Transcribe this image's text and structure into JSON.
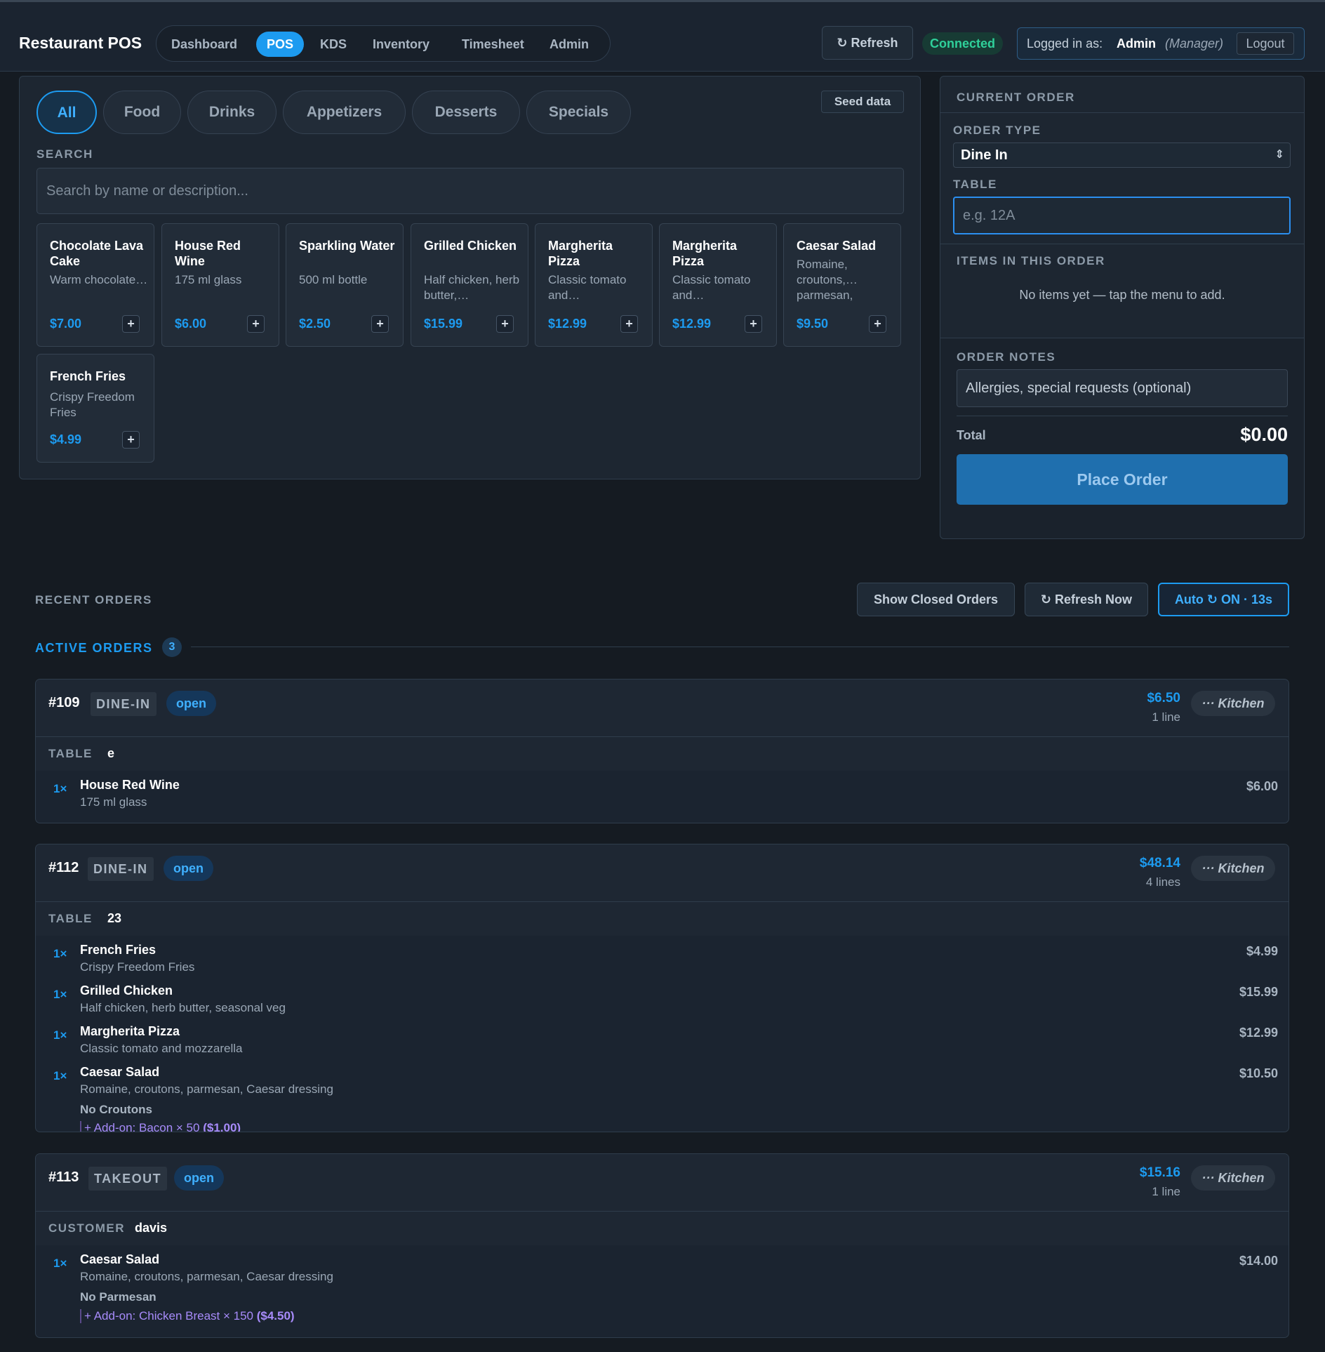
{
  "app": {
    "title": "Restaurant POS"
  },
  "nav": {
    "items": [
      "Dashboard",
      "POS",
      "KDS",
      "Inventory",
      "Timesheet",
      "Admin"
    ],
    "active": "POS"
  },
  "header": {
    "refresh_label": "Refresh",
    "status": "Connected",
    "logged_in_prefix": "Logged in as:",
    "user": "Admin",
    "role": "(Manager)",
    "logout_label": "Logout"
  },
  "menu": {
    "categories": [
      "All",
      "Food",
      "Drinks",
      "Appetizers",
      "Desserts",
      "Specials"
    ],
    "active_category": "All",
    "seed_label": "Seed data",
    "search_label": "SEARCH",
    "search_placeholder": "Search by name or description...",
    "items": [
      {
        "name": "Chocolate Lava Cake",
        "desc": "Warm chocolate…",
        "price": "$7.00"
      },
      {
        "name": "House Red Wine",
        "desc": "175 ml glass",
        "price": "$6.00"
      },
      {
        "name": "Sparkling Water",
        "desc": "500 ml bottle",
        "price": "$2.50"
      },
      {
        "name": "Grilled Chicken",
        "desc": "Half chicken, herb butter,…",
        "price": "$15.99"
      },
      {
        "name": "Margherita Pizza",
        "desc": "Classic tomato and…",
        "price": "$12.99"
      },
      {
        "name": "Margherita Pizza",
        "desc": "Classic tomato and…",
        "price": "$12.99"
      },
      {
        "name": "Caesar Salad",
        "desc": "Romaine, croutons,… parmesan,",
        "price": "$9.50"
      },
      {
        "name": "French Fries",
        "desc": "Crispy Freedom Fries",
        "price": "$4.99"
      }
    ]
  },
  "current_order": {
    "title": "CURRENT ORDER",
    "order_type_label": "ORDER TYPE",
    "order_type_value": "Dine In",
    "table_label": "TABLE",
    "table_placeholder": "e.g. 12A",
    "items_label": "ITEMS IN THIS ORDER",
    "empty_text": "No items yet — tap the menu to add.",
    "notes_label": "ORDER NOTES",
    "notes_placeholder": "Allergies, special requests (optional)",
    "total_label": "Total",
    "total_value": "$0.00",
    "place_label": "Place Order"
  },
  "recent": {
    "title": "RECENT ORDERS",
    "show_closed_label": "Show Closed Orders",
    "refresh_now_label": "Refresh Now",
    "auto_label": "Auto ↻ ON · 13s",
    "active_label": "ACTIVE ORDERS",
    "active_count": "3",
    "orders": [
      {
        "number": "#109",
        "type": "DINE-IN",
        "status": "open",
        "total": "$6.50",
        "lines": "1 line",
        "kitchen_label": "··· Kitchen",
        "meta_label": "TABLE",
        "meta_value": "e",
        "items": [
          {
            "qty": "1×",
            "name": "House Red Wine",
            "desc": "175 ml glass",
            "price": "$6.00"
          }
        ]
      },
      {
        "number": "#112",
        "type": "DINE-IN",
        "status": "open",
        "total": "$48.14",
        "lines": "4 lines",
        "kitchen_label": "··· Kitchen",
        "meta_label": "TABLE",
        "meta_value": "23",
        "items": [
          {
            "qty": "1×",
            "name": "French Fries",
            "desc": "Crispy Freedom Fries",
            "price": "$4.99"
          },
          {
            "qty": "1×",
            "name": "Grilled Chicken",
            "desc": "Half chicken, herb butter, seasonal veg",
            "price": "$15.99"
          },
          {
            "qty": "1×",
            "name": "Margherita Pizza",
            "desc": "Classic tomato and mozzarella",
            "price": "$12.99"
          },
          {
            "qty": "1×",
            "name": "Caesar Salad",
            "desc": "Romaine, croutons, parmesan, Caesar dressing",
            "price": "$10.50",
            "modifier": "No Croutons",
            "addon": "+ Add-on: Bacon × 50",
            "addon_price": "($1.00)"
          }
        ]
      },
      {
        "number": "#113",
        "type": "TAKEOUT",
        "status": "open",
        "total": "$15.16",
        "lines": "1 line",
        "kitchen_label": "··· Kitchen",
        "meta_label": "CUSTOMER",
        "meta_value": "davis",
        "items": [
          {
            "qty": "1×",
            "name": "Caesar Salad",
            "desc": "Romaine, croutons, parmesan, Caesar dressing",
            "price": "$14.00",
            "modifier": "No Parmesan",
            "addon": "+ Add-on: Chicken Breast × 150",
            "addon_price": "($4.50)"
          }
        ]
      }
    ]
  }
}
